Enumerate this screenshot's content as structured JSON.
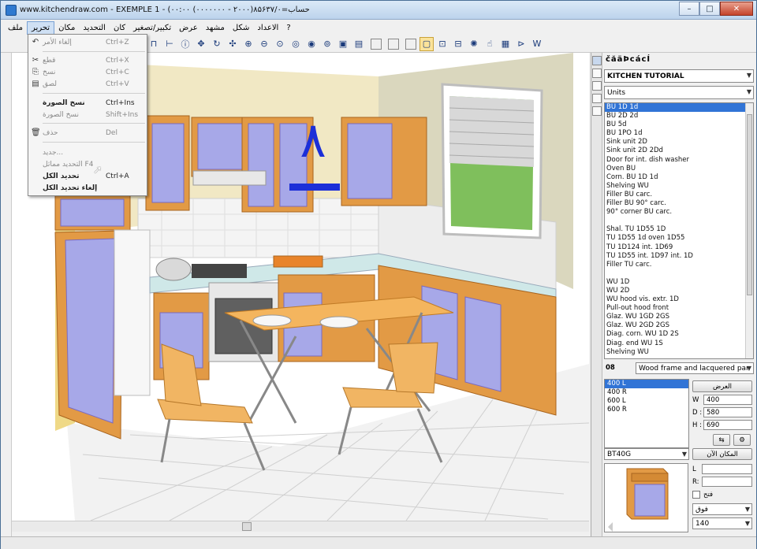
{
  "window": {
    "title": "www.kitchendraw.com - EXEMPLE 1 - (۰۰:۰۰ (۰۰۰۰۰۰۰ - ۲۰۰۰)۸۵۶۳۷/۰=حساب"
  },
  "menubar": {
    "items": [
      "ملف",
      "تحرير",
      "مكان",
      "التحديد",
      "كان",
      "تكبير/تصغير",
      "عرض",
      "مشهد",
      "شكل",
      "الاعداد",
      "?"
    ]
  },
  "edit_menu": {
    "items": [
      {
        "label": "إلغاء الأمر",
        "shortcut": "Ctrl+Z",
        "icon": "undo-icon",
        "disabled": true
      },
      {
        "label": "قطع",
        "shortcut": "Ctrl+X",
        "icon": "cut-icon",
        "disabled": true
      },
      {
        "label": "نسخ",
        "shortcut": "Ctrl+C",
        "icon": "copy-icon",
        "disabled": true
      },
      {
        "label": "لصق",
        "shortcut": "Ctrl+V",
        "icon": "paste-icon",
        "disabled": true
      },
      {
        "label": "نسخ الصورة",
        "shortcut": "Ctrl+Ins",
        "icon": "",
        "disabled": false
      },
      {
        "label": "نسخ الصورة",
        "shortcut": "Shift+Ins",
        "icon": "",
        "disabled": true
      },
      {
        "label": "حذف",
        "shortcut": "Del",
        "icon": "delete-icon",
        "disabled": true
      },
      {
        "label": "جديد...",
        "shortcut": "",
        "icon": "",
        "disabled": true
      },
      {
        "label": "التحديد مماثل F4",
        "shortcut": "",
        "icon": "",
        "disabled": true
      },
      {
        "label": "تحديد الكل",
        "shortcut": "Ctrl+A",
        "icon": "",
        "disabled": false
      },
      {
        "label": "إلغاء تحديد الكل",
        "shortcut": "",
        "icon": "",
        "disabled": false
      }
    ]
  },
  "scene": {
    "annotation_number": "٨"
  },
  "panel": {
    "title": "čăäÞcácÍ",
    "catalog": "KITCHEN TUTORIAL",
    "category": "Units",
    "items": [
      "BU 1D 1d",
      "BU 2D 2d",
      "BU 5d",
      "BU 1PO 1d",
      "Sink unit 2D",
      "Sink unit 2D 2Dd",
      "Door for int. dish washer",
      "Oven BU",
      "Corn. BU 1D 1d",
      "Shelving WU",
      "Filler BU carc.",
      "Filler BU 90° carc.",
      "90° corner BU carc.",
      "",
      "Shal. TU 1D55 1D",
      "TU 1D55 1d oven 1D55",
      "TU 1D124 int. 1D69",
      "TU 1D55 int. 1D97 int. 1D",
      "Filler TU carc.",
      "",
      "WU 1D",
      "WU 2D",
      "WU hood vis. extr. 1D",
      "Pull-out hood front",
      "Glaz. WU 1GD 2GS",
      "Glaz. WU 2GD 2GS",
      "Diag. corn. WU 1D 2S",
      "Diag. end WU 1S",
      "Shelving WU"
    ],
    "selected_index": 0,
    "finish_code": "08",
    "finish_name": "Wood frame and lacquered par",
    "dims": [
      "400 L",
      "400 R",
      "600 L",
      "600 R"
    ],
    "dims_selected": 0,
    "size_button": "العرض",
    "w_label": "W",
    "w_value": "400",
    "d_label": "D :",
    "d_value": "580",
    "h_label": "H :",
    "h_value": "690",
    "ref_combo": "BT40G",
    "place_button": "المكان الآن",
    "l_label": "L",
    "r_label": "R:",
    "open_label": "فتح",
    "pos_combo": "فوق",
    "height_combo": "140"
  }
}
